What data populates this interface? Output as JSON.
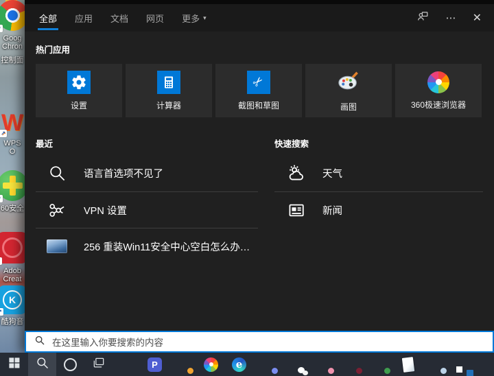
{
  "tabs": {
    "items": [
      {
        "label": "全部",
        "active": true
      },
      {
        "label": "应用"
      },
      {
        "label": "文档"
      },
      {
        "label": "网页"
      },
      {
        "label": "更多",
        "dropdown": true
      }
    ]
  },
  "topbar": {
    "ellipsis": "⋯",
    "close": "✕"
  },
  "hot_apps": {
    "header": "热门应用",
    "tiles": [
      {
        "label": "设置",
        "icon": "settings"
      },
      {
        "label": "计算器",
        "icon": "calculator"
      },
      {
        "label": "截图和草图",
        "icon": "snip"
      },
      {
        "label": "画图",
        "icon": "paint"
      },
      {
        "label": "360极速浏览器",
        "icon": "pinwheel"
      }
    ]
  },
  "recent": {
    "header": "最近",
    "items": [
      {
        "label": "语言首选项不见了",
        "icon": "search"
      },
      {
        "label": "VPN 设置",
        "icon": "vpn"
      },
      {
        "label": "256 重装Win11安全中心空白怎么办视...",
        "icon": "video-thumb"
      }
    ]
  },
  "quick_search": {
    "header": "快速搜索",
    "items": [
      {
        "label": "天气",
        "icon": "weather"
      },
      {
        "label": "新闻",
        "icon": "news"
      }
    ]
  },
  "search_box": {
    "placeholder": "在这里输入你要搜索的内容"
  },
  "desktop": {
    "icons": [
      {
        "label": "控制面",
        "name": "control-panel"
      },
      {
        "label": "WPS O",
        "icon": "wps",
        "name": "wps-office"
      },
      {
        "label": "60安全",
        "icon": "safe360",
        "name": "360-safe"
      },
      {
        "label": "Adob\nCreat",
        "icon": "adobecc",
        "name": "adobe-creative-cloud"
      },
      {
        "label": "酷狗音",
        "icon": "kugou",
        "name": "kugou"
      },
      {
        "label": "Goog\nChron",
        "icon": "chrome-big",
        "name": "google-chrome"
      }
    ]
  },
  "taskbar": {
    "items": [
      {
        "name": "start",
        "icon": "start"
      },
      {
        "name": "search",
        "icon": "tb-search",
        "highlight": true
      },
      {
        "name": "cortana",
        "icon": "cortana"
      },
      {
        "name": "task-view",
        "icon": "task-view"
      },
      {
        "name": "chrome-1",
        "icon": "chrome"
      },
      {
        "name": "blue-p-app",
        "icon": "blue-p"
      },
      {
        "name": "chrome-2",
        "icon": "chrome",
        "badge": "#f0a432"
      },
      {
        "name": "360-browser",
        "icon": "pinwheel-sm"
      },
      {
        "name": "edge",
        "icon": "edge"
      },
      {
        "name": "chrome-3",
        "icon": "chrome",
        "badge": "#7b8df0"
      },
      {
        "name": "wechat",
        "icon": "wechat"
      },
      {
        "name": "chrome-4",
        "icon": "chrome",
        "badge": "#f093ae"
      },
      {
        "name": "chrome-5",
        "icon": "chrome",
        "badge": "#7a1f33"
      },
      {
        "name": "chrome-6",
        "icon": "chrome",
        "badge": "#3f9d4e"
      },
      {
        "name": "notepad",
        "icon": "notepad"
      },
      {
        "name": "chrome-7",
        "icon": "chrome",
        "badge": "#bcd3e8"
      },
      {
        "name": "vmware",
        "icon": "vmware"
      }
    ]
  },
  "colors": {
    "accent": "#0078d7",
    "panel_bg": "#202020",
    "tile_bg": "#2c2c2c",
    "taskbar_bg": "#262b34"
  }
}
